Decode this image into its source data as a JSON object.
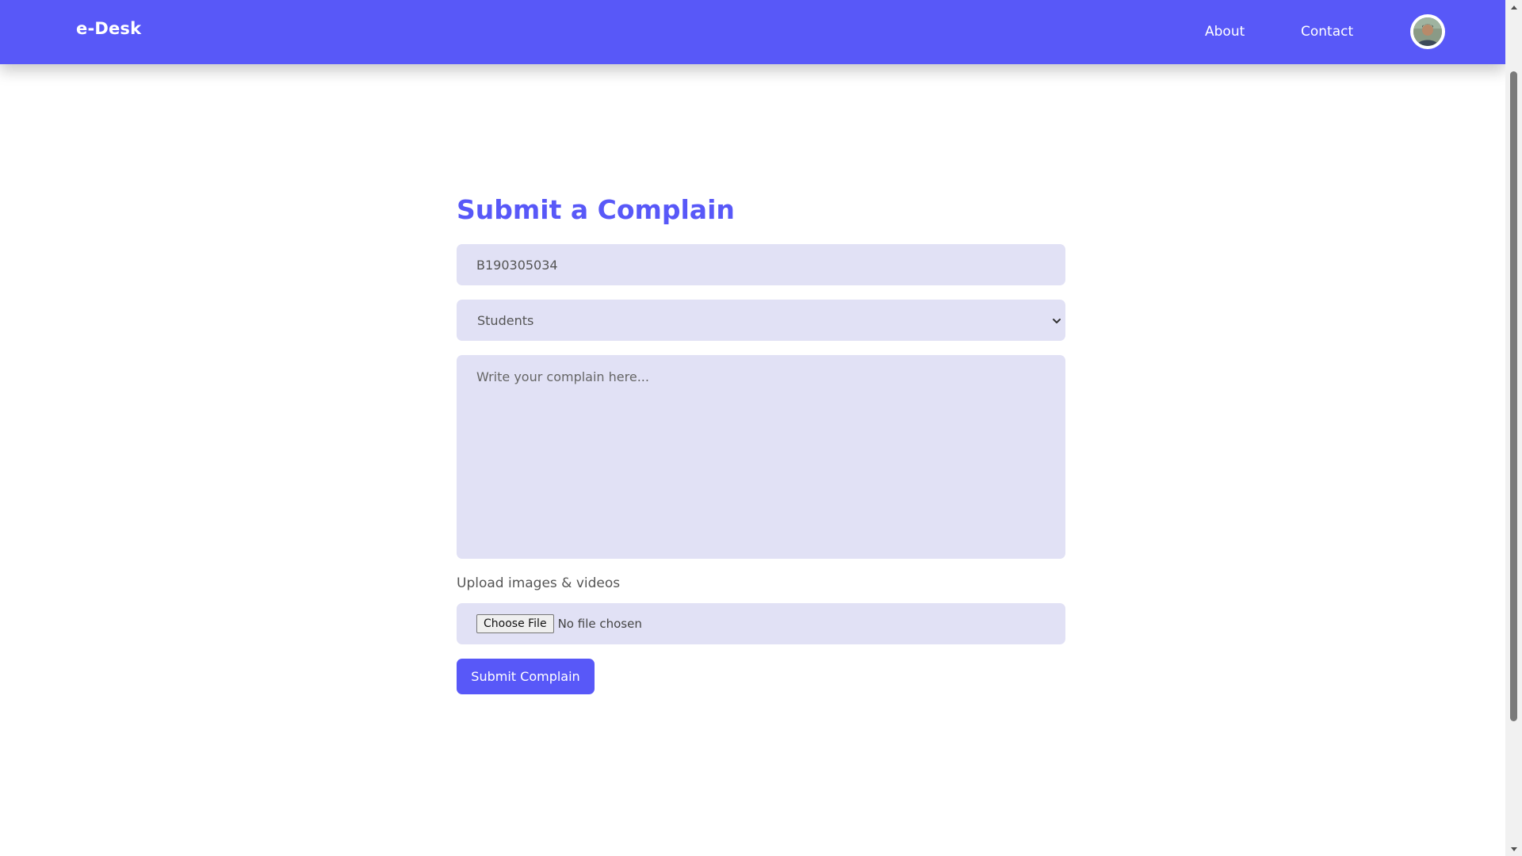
{
  "header": {
    "brand": "e-Desk",
    "nav": {
      "about": "About",
      "contact": "Contact"
    },
    "avatar_icon": "user-avatar-photo",
    "background_color": "#5858f8"
  },
  "form": {
    "title": "Submit a Complain",
    "id_field": {
      "value": "B190305034"
    },
    "category_select": {
      "selected": "Students"
    },
    "complaint_textarea": {
      "placeholder": "Write your complain here..."
    },
    "upload": {
      "label": "Upload images & videos",
      "button_label": "Choose File",
      "status": "No file chosen"
    },
    "submit_label": "Submit Complain",
    "field_background": "#e1e1f5",
    "accent_color": "#5858f8"
  },
  "icons": {
    "select_chevron": "chevron-down-icon",
    "scroll_up": "arrow-up-icon",
    "scroll_down": "arrow-down-icon"
  }
}
